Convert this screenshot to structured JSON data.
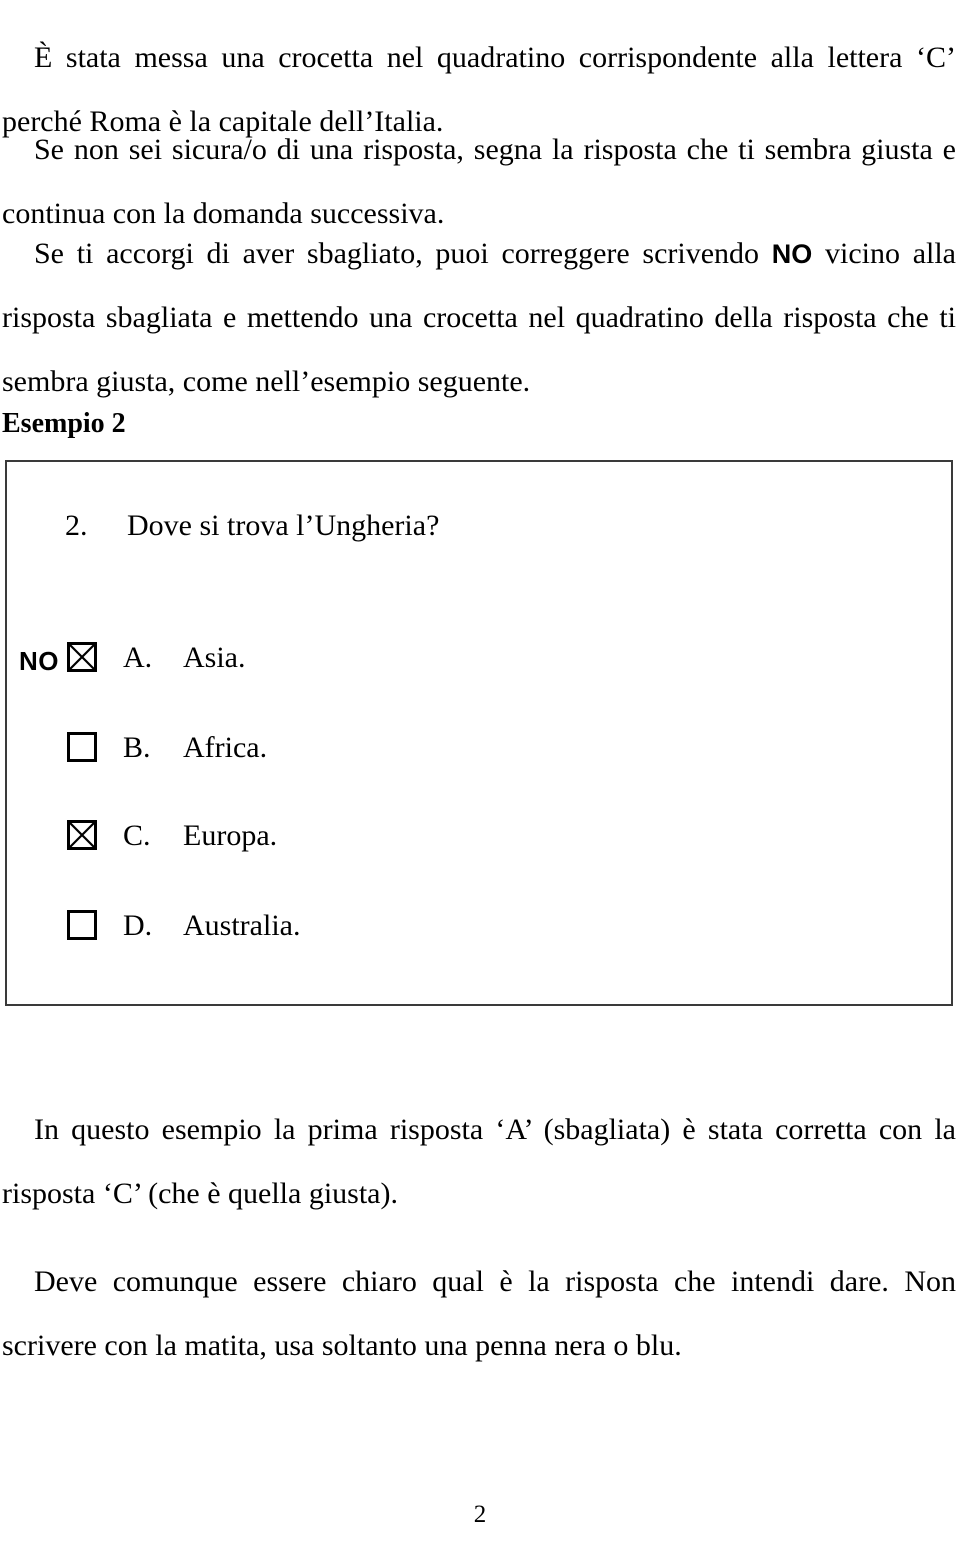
{
  "document": {
    "page_number": "2",
    "paragraphs": [
      {
        "id": "p1",
        "text": "È stata messa una crocetta nel quadratino corrispondente alla lettera ‘C’ perché Roma è la capitale dell’Italia."
      },
      {
        "id": "p2",
        "text": "Se non sei sicura/o di una risposta, segna la risposta che ti sembra giusta e continua con la domanda successiva."
      },
      {
        "id": "p3_part1",
        "text": "Se ti accorgi di aver sbagliato, puoi correggere scrivendo "
      },
      {
        "id": "p3_emphasis",
        "text": "NO"
      },
      {
        "id": "p3_part2",
        "text": " vicino alla risposta sbagliata e mettendo una crocetta nel quadratino della risposta che ti sembra giusta, come nell’esempio seguente."
      },
      {
        "id": "p4",
        "text": "In questo esempio la prima risposta ‘A’ (sbagliata) è stata corretta con la risposta ‘C’ (che è quella giusta)."
      },
      {
        "id": "p5",
        "text": "Deve comunque essere chiaro qual è la risposta che intendi dare. Non scrivere con la matita, usa soltanto una penna nera o blu."
      }
    ],
    "heading": {
      "label": "Esempio 2"
    },
    "example_box": {
      "question": {
        "number": "2.",
        "text": "Dove si trova l’Ungheria?"
      },
      "options": [
        {
          "letter": "A.",
          "text": "Asia.",
          "checked": true,
          "crossed_out_mark": "NO",
          "mark_icon": "x-checkbox-icon"
        },
        {
          "letter": "B.",
          "text": "Africa.",
          "checked": false,
          "crossed_out_mark": "",
          "mark_icon": "empty-checkbox-icon"
        },
        {
          "letter": "C.",
          "text": "Europa.",
          "checked": true,
          "crossed_out_mark": "",
          "mark_icon": "x-checkbox-icon"
        },
        {
          "letter": "D.",
          "text": "Australia.",
          "checked": false,
          "crossed_out_mark": "",
          "mark_icon": "empty-checkbox-icon"
        }
      ]
    },
    "colors": {
      "text": "#000000",
      "box_border": "#3a3a3a",
      "background": "#ffffff"
    }
  }
}
